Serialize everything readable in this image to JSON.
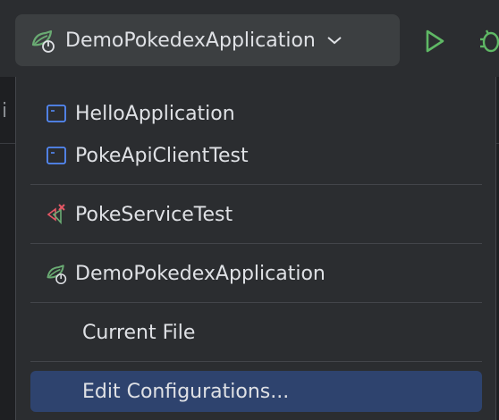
{
  "toolbar": {
    "run_config_label": "DemoPokedexApplication"
  },
  "menu": {
    "items": [
      {
        "label": "HelloApplication",
        "icon": "application-config-icon"
      },
      {
        "label": "PokeApiClientTest",
        "icon": "application-config-icon"
      },
      {
        "label": "PokeServiceTest",
        "icon": "junit-test-failed-icon"
      },
      {
        "label": "DemoPokedexApplication",
        "icon": "spring-boot-icon"
      },
      {
        "label": "Current File"
      },
      {
        "label": "Edit Configurations..."
      }
    ]
  },
  "colors": {
    "selection": "#2e436e",
    "run_green": "#5fb865",
    "spring_green": "#6aab73",
    "error_red": "#e55765"
  }
}
